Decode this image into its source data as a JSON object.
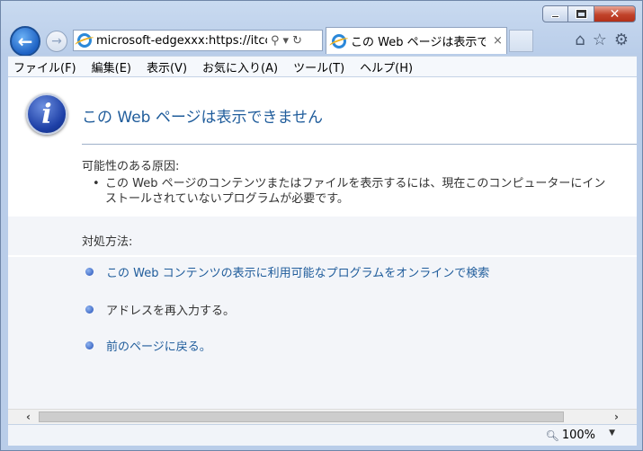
{
  "window": {
    "minimize_icon": "minimize-icon",
    "maximize_icon": "maximize-icon",
    "close_glyph": "✕"
  },
  "nav": {
    "back_glyph": "←",
    "forward_glyph": "→",
    "address": "microsoft-edgexxx:https://itccor",
    "search_glyph": "⚲",
    "dropdown_glyph": "▾",
    "refresh_glyph": "↻"
  },
  "tab": {
    "title": "この Web ページは表示で...",
    "close": "×"
  },
  "toolbar_icons": {
    "home": "⌂",
    "favorites": "☆",
    "settings": "⚙"
  },
  "menu": [
    "ファイル(F)",
    "編集(E)",
    "表示(V)",
    "お気に入り(A)",
    "ツール(T)",
    "ヘルプ(H)"
  ],
  "page": {
    "info_glyph": "i",
    "title": "この Web ページは表示できません",
    "cause_heading": "可能性のある原因:",
    "cause_bullet": "•",
    "cause_text_1": "この Web ページのコンテンツまたはファイルを表示するには、現在このコンピューターにイン",
    "cause_text_2": "ストールされていないプログラムが必要です。",
    "fix_heading": "対処方法:",
    "fixes": [
      {
        "text": "この Web コンテンツの表示に利用可能なプログラムをオンラインで検索",
        "link": true
      },
      {
        "text": "アドレスを再入力する。",
        "link": false
      },
      {
        "text": "前のページに戻る。",
        "link": true
      }
    ]
  },
  "scrollbar": {
    "left": "‹",
    "right": "›"
  },
  "status": {
    "zoom_icon": "zoom-icon",
    "zoom": "100%",
    "zoom_dropdown": "▼"
  },
  "colors": {
    "link": "#1f5c9b",
    "title_bar": "#b9cde9",
    "close_button": "#c1432a"
  }
}
